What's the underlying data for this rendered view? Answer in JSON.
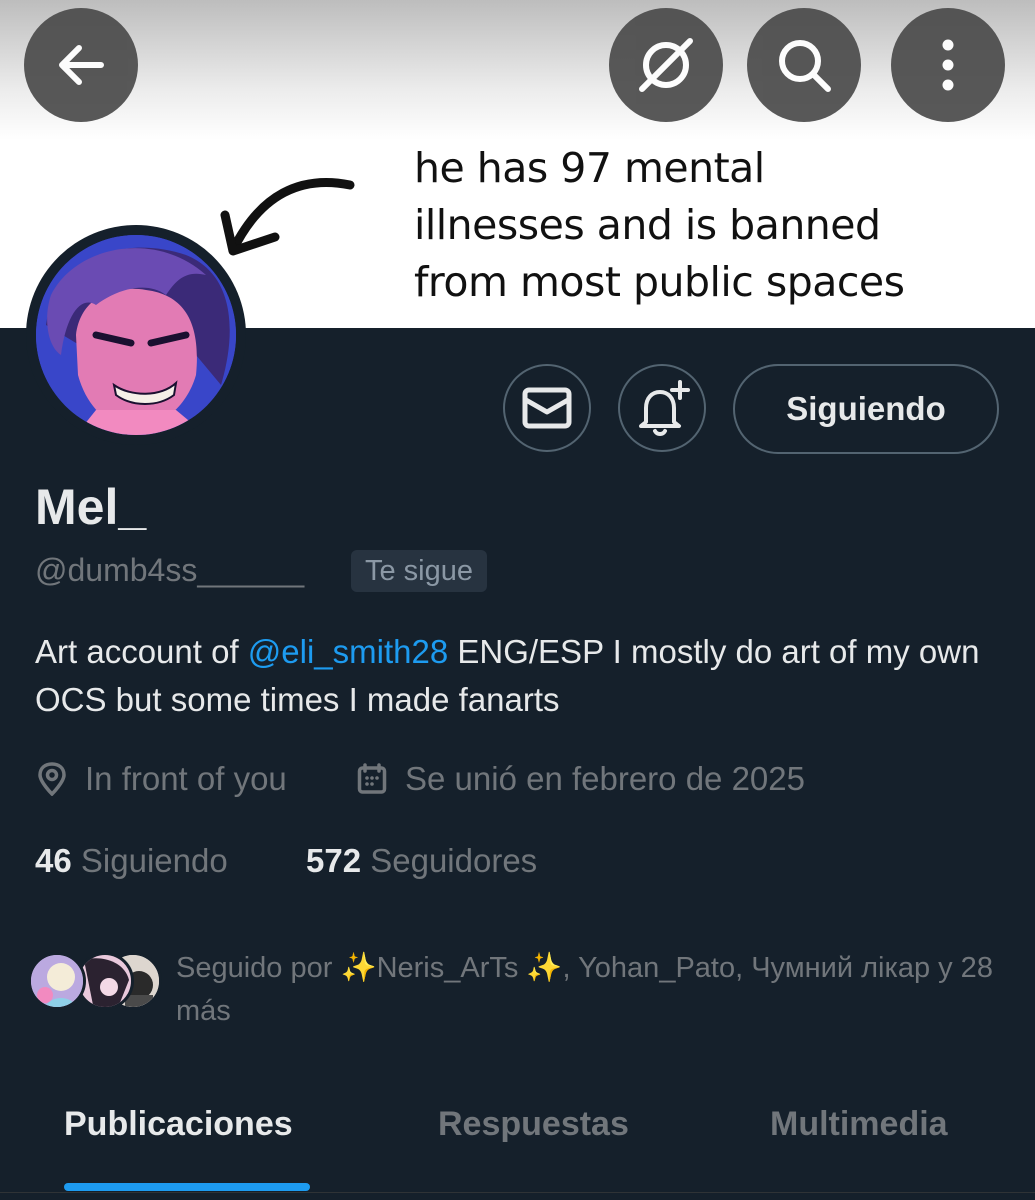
{
  "header": {
    "back_icon": "arrow-left-icon",
    "grok_icon": "slash-circle-icon",
    "search_icon": "search-icon",
    "more_icon": "more-vertical-icon"
  },
  "banner": {
    "caption": "he has 97 mental\nillnesses and is banned\nfrom most public spaces"
  },
  "actions": {
    "message_icon": "envelope-icon",
    "notify_icon": "bell-plus-icon",
    "follow_label": "Siguiendo"
  },
  "profile": {
    "name": "Mel_",
    "handle": "@dumb4ss______",
    "follows_you": "Te sigue",
    "bio_prefix": "Art account of ",
    "bio_mention": "@eli_smith28",
    "bio_suffix": " ENG/ESP  I mostly do art of my own OCS but some times I made fanarts",
    "location": "In front of you",
    "joined": "Se unió en febrero de 2025",
    "following_count": "46",
    "following_label": "Siguiendo",
    "followers_count": "572",
    "followers_label": "Seguidores",
    "followed_by": "Seguido por ✨Neris_ArTs ✨, Yohan_Pato, Чумний лікар y 28 más"
  },
  "tabs": [
    "Publicaciones",
    "Respuestas",
    "Multimedia"
  ],
  "colors": {
    "accent": "#1d9bf0",
    "background": "#15202b",
    "muted": "#71767b"
  }
}
